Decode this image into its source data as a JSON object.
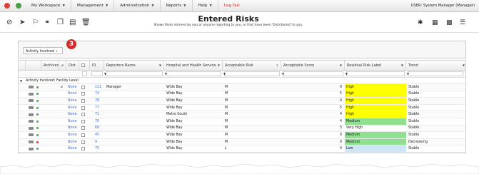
{
  "nav": {
    "workspace": "My Workspace",
    "management": "Management",
    "administration": "Administration",
    "reports": "Reports",
    "help": "Help",
    "logout": "Log Out",
    "user": "USER: System Manager (Manager)"
  },
  "header": {
    "title": "Entered Risks",
    "subtitle": "Shows Risks entered by you or anyone reporting to you, or that have been 'Distributed' to you."
  },
  "group_panel": {
    "chip_label": "Activity Involved",
    "badge": "3"
  },
  "columns": {
    "archived": "Archived",
    "dist": "Dist",
    "id": "ID",
    "reporters_name": "Reporters Name",
    "hhs": "Hospital and Health Service",
    "acceptable_risk": "Acceptable Risk",
    "acceptable_score": "Acceptable Score",
    "residual_label": "Residual Risk Label",
    "trend": "Trend"
  },
  "group_row": {
    "label": "Activity Involved: Facility Level"
  },
  "rows": [
    {
      "dist": "None",
      "id": "111",
      "reporter": "Manager",
      "hhs": "Wide Bay",
      "acc": "M",
      "score": "0",
      "label": "High",
      "trend": "Stable",
      "color": "#ffff00",
      "dot": "#3fae49",
      "clip": true
    },
    {
      "dist": "None",
      "id": "74",
      "reporter": "",
      "hhs": "Wide Bay",
      "acc": "M",
      "score": "5",
      "label": "High",
      "trend": "Stable",
      "color": "#ffff00",
      "dot": "#3fae49",
      "clip": false
    },
    {
      "dist": "None",
      "id": "78",
      "reporter": "",
      "hhs": "Wide Bay",
      "acc": "M",
      "score": "4",
      "label": "High",
      "trend": "Stable",
      "color": "#ffff00",
      "dot": "#3fae49",
      "clip": false
    },
    {
      "dist": "None",
      "id": "77",
      "reporter": "",
      "hhs": "Wide Bay",
      "acc": "M",
      "score": "5",
      "label": "High",
      "trend": "Stable",
      "color": "#ffff00",
      "dot": "#3fae49",
      "clip": false
    },
    {
      "dist": "None",
      "id": "71",
      "reporter": "",
      "hhs": "Metro South",
      "acc": "M",
      "score": "4",
      "label": "High",
      "trend": "Stable",
      "color": "#ffff00",
      "dot": "#3fae49",
      "clip": false
    },
    {
      "dist": "None",
      "id": "76",
      "reporter": "",
      "hhs": "Wide Bay",
      "acc": "M",
      "score": "4",
      "label": "Medium",
      "trend": "Stable",
      "color": "#8fe08f",
      "dot": "#3fae49",
      "clip": false
    },
    {
      "dist": "None",
      "id": "69",
      "reporter": "",
      "hhs": "Wide Bay",
      "acc": "M",
      "score": "5",
      "label": "Very High",
      "trend": "Stable",
      "color": "#ffffff",
      "dot": "#3fae49",
      "clip": false
    },
    {
      "dist": "None",
      "id": "45",
      "reporter": "",
      "hhs": "Wide Bay",
      "acc": "M",
      "score": "0",
      "label": "Medium",
      "trend": "Stable",
      "color": "#8fe08f",
      "dot": "#3fae49",
      "clip": false
    },
    {
      "dist": "None",
      "id": "9",
      "reporter": "",
      "hhs": "Wide Bay",
      "acc": "M",
      "score": "0",
      "label": "Medium",
      "trend": "Decreasing",
      "color": "#8fe08f",
      "dot": "#d83a3a",
      "clip": false
    },
    {
      "dist": "None",
      "id": "75",
      "reporter": "",
      "hhs": "Wide Bay",
      "acc": "L",
      "score": "4",
      "label": "Low",
      "trend": "Stable",
      "color": "#cfe6f5",
      "dot": "#3fae49",
      "clip": false
    }
  ]
}
